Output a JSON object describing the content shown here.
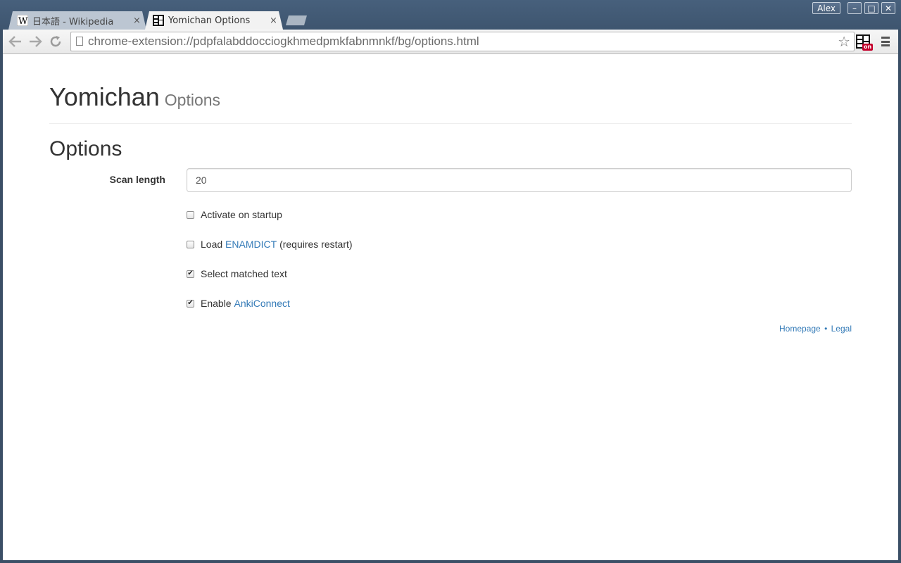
{
  "browser": {
    "tabs": [
      {
        "title": "日本語 - Wikipedia",
        "favicon": "wikipedia-w-icon",
        "active": false
      },
      {
        "title": "Yomichan Options",
        "favicon": "yomichan-icon",
        "active": true
      }
    ],
    "close_glyph": "×",
    "window": {
      "user": "Alex",
      "minimize": "–",
      "maximize": "□",
      "close": "✕"
    },
    "address_bar": {
      "url": "chrome-extension://pdpfalabddocciogkhmedpmkfabnmnkf/bg/options.html"
    },
    "extension_badge": "on"
  },
  "page": {
    "title": "Yomichan",
    "title_small": "Options",
    "section_heading": "Options",
    "scan_length": {
      "label": "Scan length",
      "value": "20"
    },
    "checkboxes": [
      {
        "label": "Activate on startup",
        "checked": false
      },
      {
        "prefix": "Load",
        "link": "ENAMDICT",
        "suffix": "(requires restart)",
        "checked": false
      },
      {
        "label": "Select matched text",
        "checked": true
      },
      {
        "prefix": "Enable",
        "link": "AnkiConnect",
        "checked": true
      }
    ],
    "footer": {
      "homepage": "Homepage",
      "separator": "•",
      "legal": "Legal"
    }
  },
  "colors": {
    "link": "#337ab7",
    "frame": "#3b4f66",
    "badge": "#c4002b"
  }
}
